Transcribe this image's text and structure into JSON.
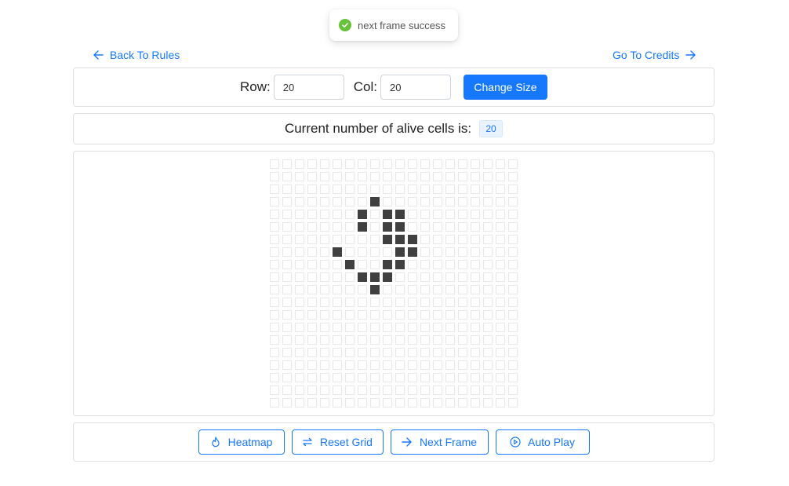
{
  "toast": {
    "message": "next frame success",
    "icon": "check-circle-icon",
    "color": "#67c23a"
  },
  "nav": {
    "back_label": "Back To Rules",
    "credits_label": "Go To Credits"
  },
  "size_form": {
    "row_label": "Row:",
    "row_value": "20",
    "col_label": "Col:",
    "col_value": "20",
    "change_label": "Change Size"
  },
  "status": {
    "label": "Current number of alive cells is:",
    "count": "20"
  },
  "grid": {
    "rows": 20,
    "cols": 20,
    "alive_cells": [
      [
        3,
        8
      ],
      [
        4,
        7
      ],
      [
        4,
        9
      ],
      [
        4,
        10
      ],
      [
        5,
        7
      ],
      [
        5,
        9
      ],
      [
        5,
        10
      ],
      [
        6,
        9
      ],
      [
        6,
        10
      ],
      [
        6,
        11
      ],
      [
        7,
        5
      ],
      [
        7,
        10
      ],
      [
        7,
        11
      ],
      [
        8,
        6
      ],
      [
        8,
        9
      ],
      [
        8,
        10
      ],
      [
        9,
        7
      ],
      [
        9,
        8
      ],
      [
        9,
        9
      ],
      [
        10,
        8
      ]
    ]
  },
  "actions": {
    "heatmap_label": "Heatmap",
    "reset_label": "Reset Grid",
    "next_label": "Next Frame",
    "auto_label": "Auto Play"
  },
  "colors": {
    "accent": "#1677ff",
    "alive": "#404040",
    "border": "#dcdfe6",
    "success": "#67c23a"
  }
}
